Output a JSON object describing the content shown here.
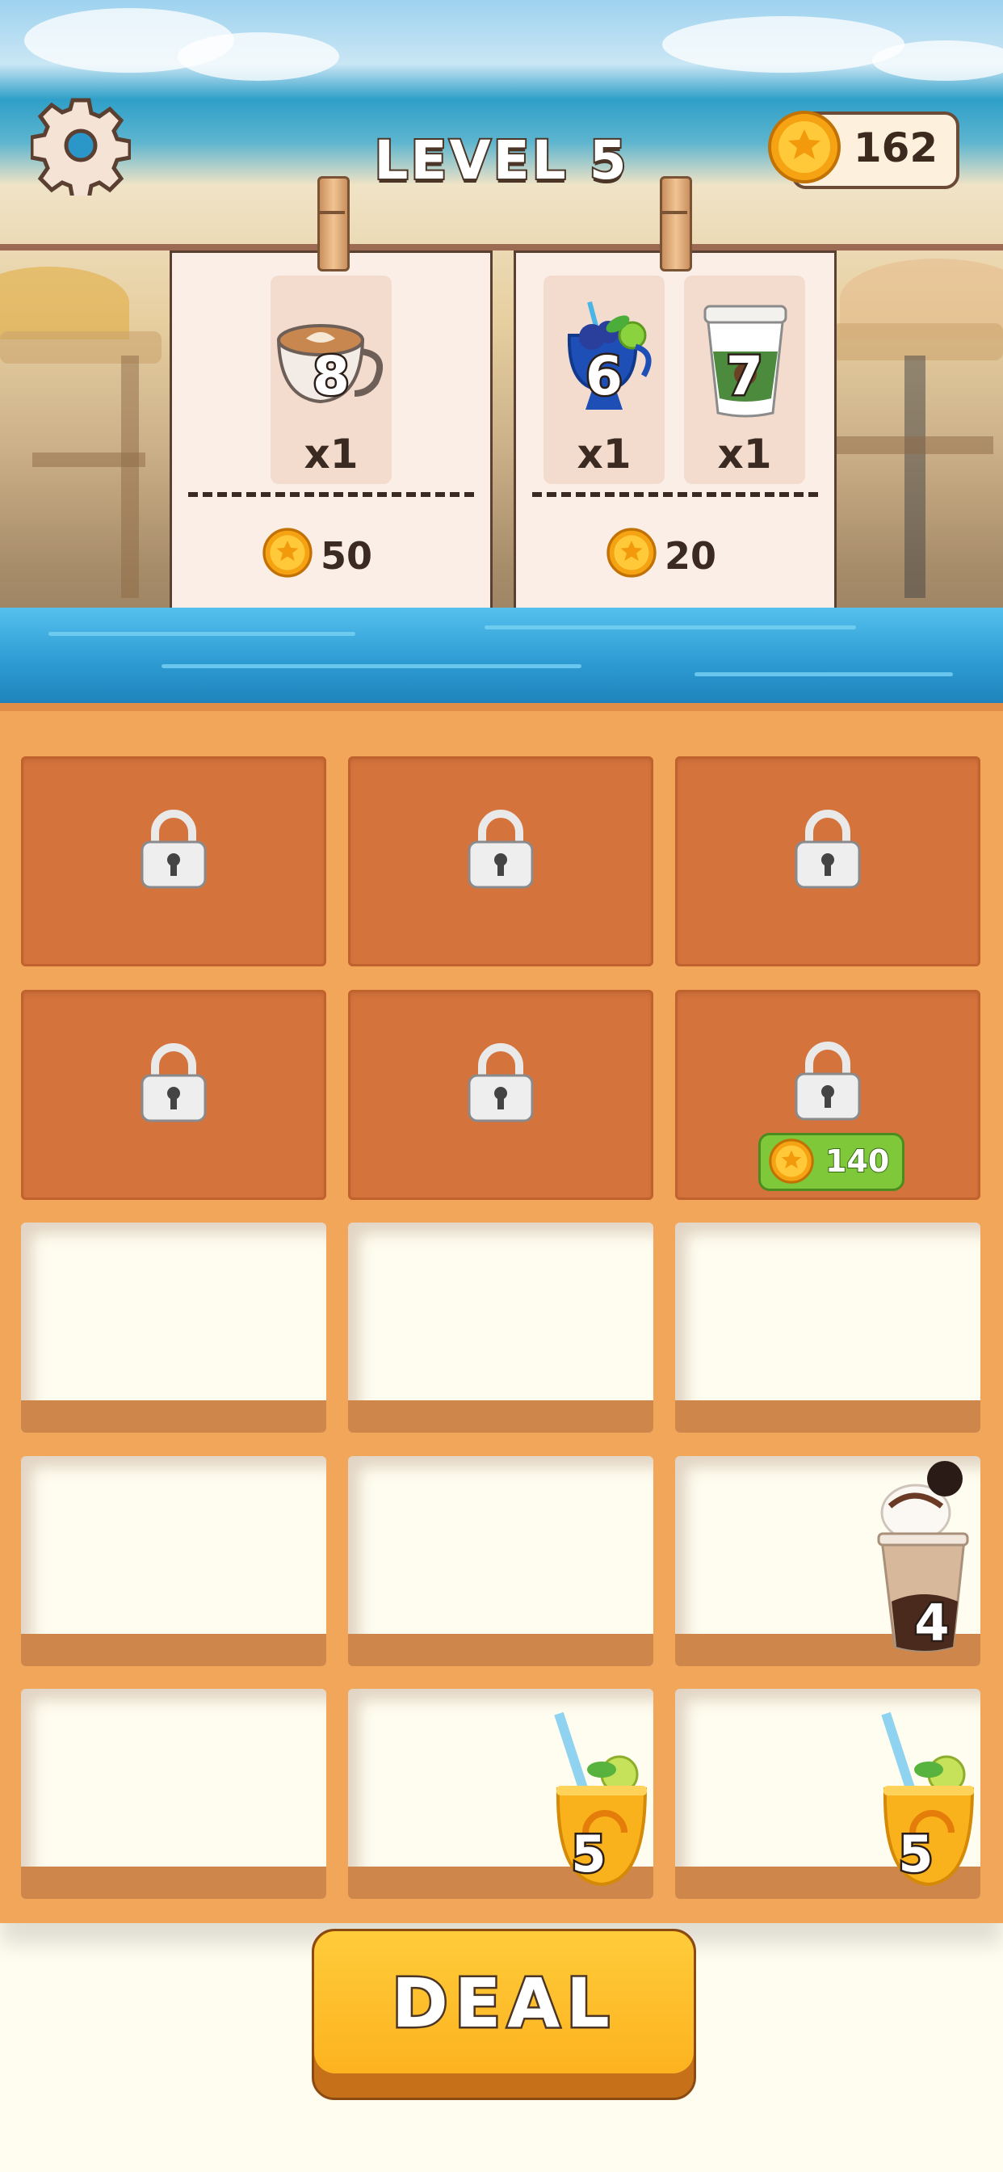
{
  "header": {
    "settings_icon": "gear-icon",
    "level_label": "LEVEL 5",
    "coins": "162"
  },
  "orders": [
    {
      "items": [
        {
          "icon": "latte-cup-icon",
          "number": "8",
          "qty": "x1"
        }
      ],
      "reward": "50"
    },
    {
      "items": [
        {
          "icon": "blue-cocktail-icon",
          "number": "6",
          "qty": "x1"
        },
        {
          "icon": "takeaway-coffee-cup-icon",
          "number": "7",
          "qty": "x1"
        }
      ],
      "reward": "20"
    }
  ],
  "board": {
    "unlock_cost": "140",
    "items": [
      {
        "name": "milkshake-icon",
        "number": "4"
      },
      {
        "name": "lemonade-icon",
        "number": "5"
      },
      {
        "name": "lemonade-icon",
        "number": "5"
      }
    ]
  },
  "colors": {
    "board": "#f1a659",
    "locked_cell": "#d5733c",
    "deal_button": "#fdb21f",
    "unlock_badge": "#7fc83a",
    "water": "#2c9ad1"
  },
  "deal_button": {
    "label": "DEAL"
  }
}
